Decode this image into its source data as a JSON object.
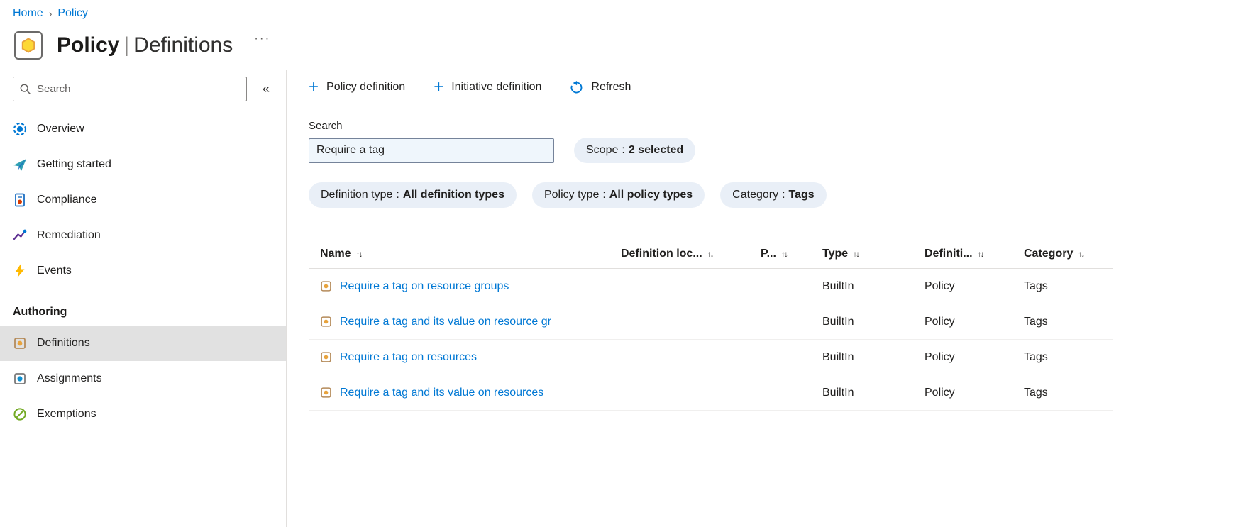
{
  "breadcrumb": {
    "items": [
      {
        "label": "Home"
      },
      {
        "label": "Policy"
      }
    ],
    "separator": "›"
  },
  "header": {
    "title_bold": "Policy",
    "title_pipe": "|",
    "title_rest": "Definitions",
    "more_label": "···"
  },
  "sidebar": {
    "search_placeholder": "Search",
    "collapse_glyph": "«",
    "items": [
      {
        "label": "Overview"
      },
      {
        "label": "Getting started"
      },
      {
        "label": "Compliance"
      },
      {
        "label": "Remediation"
      },
      {
        "label": "Events"
      }
    ],
    "section_label": "Authoring",
    "authoring_items": [
      {
        "label": "Definitions",
        "selected": true
      },
      {
        "label": "Assignments",
        "selected": false
      },
      {
        "label": "Exemptions",
        "selected": false
      }
    ]
  },
  "toolbar": {
    "policy_definition_label": "Policy definition",
    "initiative_definition_label": "Initiative definition",
    "refresh_label": "Refresh",
    "plus_glyph": "+"
  },
  "filters": {
    "search_label": "Search",
    "search_value": "Require a tag",
    "pills": [
      {
        "name": "Scope",
        "sep": ":",
        "value": "2 selected"
      },
      {
        "name": "Definition type",
        "sep": ":",
        "value": "All definition types"
      },
      {
        "name": "Policy type",
        "sep": ":",
        "value": "All policy types"
      },
      {
        "name": "Category",
        "sep": ":",
        "value": "Tags"
      }
    ]
  },
  "table": {
    "sort_glyph": "↑↓",
    "columns": [
      "Name",
      "Definition loc...",
      "P...",
      "Type",
      "Definiti...",
      "Category"
    ],
    "rows": [
      {
        "name": "Require a tag on resource groups",
        "definition_location": "",
        "p": "",
        "type": "BuiltIn",
        "definition_type": "Policy",
        "category": "Tags"
      },
      {
        "name": "Require a tag and its value on resource gr",
        "definition_location": "",
        "p": "",
        "type": "BuiltIn",
        "definition_type": "Policy",
        "category": "Tags"
      },
      {
        "name": "Require a tag on resources",
        "definition_location": "",
        "p": "",
        "type": "BuiltIn",
        "definition_type": "Policy",
        "category": "Tags"
      },
      {
        "name": "Require a tag and its value on resources",
        "definition_location": "",
        "p": "",
        "type": "BuiltIn",
        "definition_type": "Policy",
        "category": "Tags"
      }
    ]
  },
  "colors": {
    "accent": "#0078d4",
    "link": "#0078d4",
    "pill_bg": "#e9eff7",
    "input_bg": "#eff6fc",
    "selected_bg": "#e1e1e1"
  }
}
